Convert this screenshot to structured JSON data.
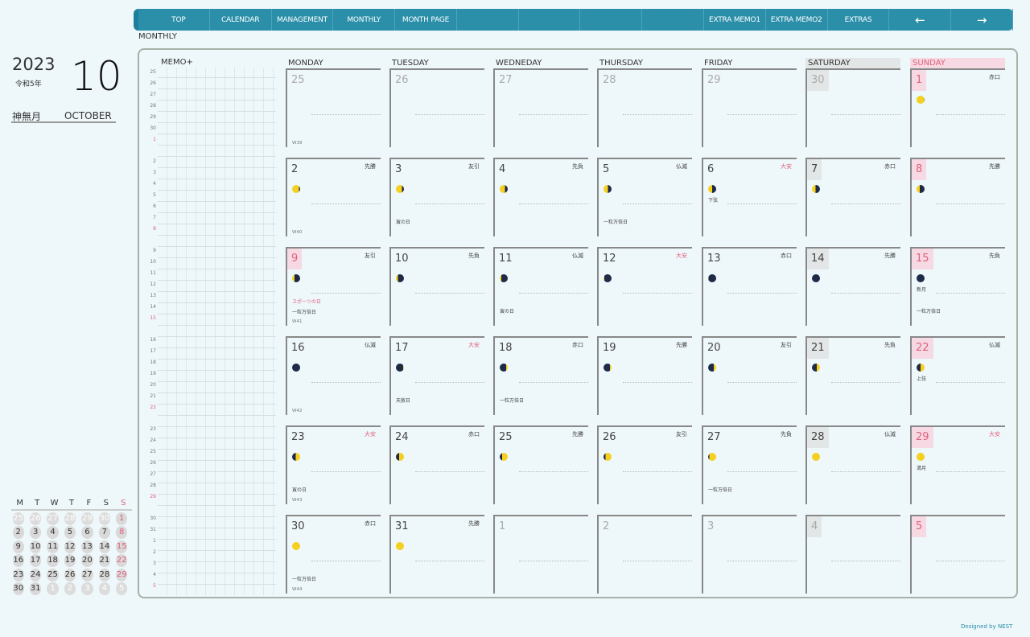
{
  "nav": [
    "TOP",
    "CALENDAR",
    "MANAGEMENT",
    "MONTHLY",
    "MONTH PAGE",
    "",
    "",
    "",
    "",
    "EXTRA MEMO1",
    "EXTRA MEMO2",
    "EXTRAS",
    "←",
    "→"
  ],
  "breadcrumb": "MONTHLY",
  "year": "2023",
  "era": "令和5年",
  "month_number": "10",
  "month_kanji": "神無月",
  "month_english": "OCTOBER",
  "memo_title": "MEMO+",
  "weekdays": [
    "MONDAY",
    "TUESDAY",
    "WEDNEDAY",
    "THURSDAY",
    "FRIDAY",
    "SATURDAY",
    "SUNDAY"
  ],
  "colors": {
    "accent": "#2b8faa",
    "sunday": "#e0607e",
    "saturday_bg": "#e3e6e6",
    "sunday_bg": "#f6d9e2",
    "moon_lit": "#f5d020",
    "moon_dark": "#1f2a48"
  },
  "memo_labels": [
    [
      "25",
      "26",
      "27",
      "28",
      "29",
      "30",
      "1"
    ],
    [
      "2",
      "3",
      "4",
      "5",
      "6",
      "7",
      "8"
    ],
    [
      "9",
      "10",
      "11",
      "12",
      "13",
      "14",
      "15"
    ],
    [
      "16",
      "17",
      "18",
      "19",
      "20",
      "21",
      "22"
    ],
    [
      "23",
      "24",
      "25",
      "26",
      "27",
      "28",
      "29"
    ],
    [
      "30",
      "31",
      "1",
      "2",
      "3",
      "4",
      "5"
    ]
  ],
  "weeks": [
    {
      "label": "W39",
      "days": [
        {
          "date": "25",
          "muted": true
        },
        {
          "date": "26",
          "muted": true
        },
        {
          "date": "27",
          "muted": true
        },
        {
          "date": "28",
          "muted": true
        },
        {
          "date": "29",
          "muted": true
        },
        {
          "date": "30",
          "muted": true
        },
        {
          "date": "1",
          "rokuyo": "赤口",
          "moon": {
            "lit": 0.95,
            "side": "left"
          }
        }
      ]
    },
    {
      "label": "W40",
      "days": [
        {
          "date": "2",
          "rokuyo": "先勝",
          "moon": {
            "lit": 0.85,
            "side": "left"
          }
        },
        {
          "date": "3",
          "rokuyo": "友引",
          "moon": {
            "lit": 0.75,
            "side": "left"
          },
          "note": "寅の日"
        },
        {
          "date": "4",
          "rokuyo": "先負",
          "moon": {
            "lit": 0.65,
            "side": "left"
          }
        },
        {
          "date": "5",
          "rokuyo": "仏滅",
          "moon": {
            "lit": 0.55,
            "side": "left"
          },
          "note": "一粒万倍日"
        },
        {
          "date": "6",
          "rokuyo": "大安",
          "moon": {
            "lit": 0.5,
            "side": "left"
          },
          "moon_label": "下弦"
        },
        {
          "date": "7",
          "rokuyo": "赤口",
          "moon": {
            "lit": 0.45,
            "side": "left"
          }
        },
        {
          "date": "8",
          "rokuyo": "先勝",
          "moon": {
            "lit": 0.4,
            "side": "left"
          }
        }
      ]
    },
    {
      "label": "W41",
      "days": [
        {
          "date": "9",
          "rokuyo": "友引",
          "moon": {
            "lit": 0.3,
            "side": "left"
          },
          "holiday": "スポーツの日",
          "note": "一粒万倍日"
        },
        {
          "date": "10",
          "rokuyo": "先負",
          "moon": {
            "lit": 0.25,
            "side": "left"
          }
        },
        {
          "date": "11",
          "rokuyo": "仏滅",
          "moon": {
            "lit": 0.2,
            "side": "left"
          },
          "note": "寅の日"
        },
        {
          "date": "12",
          "rokuyo": "大安",
          "moon": {
            "lit": 0.12,
            "side": "left"
          }
        },
        {
          "date": "13",
          "rokuyo": "赤口",
          "moon": {
            "lit": 0.03,
            "side": "left"
          }
        },
        {
          "date": "14",
          "rokuyo": "先勝",
          "moon": {
            "lit": 0,
            "side": "left"
          }
        },
        {
          "date": "15",
          "rokuyo": "先負",
          "moon": {
            "lit": 0,
            "side": "left"
          },
          "moon_label": "新月",
          "note": "一粒万倍日"
        }
      ]
    },
    {
      "label": "W42",
      "days": [
        {
          "date": "16",
          "rokuyo": "仏滅",
          "moon": {
            "lit": 0.02,
            "side": "right"
          }
        },
        {
          "date": "17",
          "rokuyo": "大安",
          "moon": {
            "lit": 0.12,
            "side": "right"
          },
          "note": "天赦日"
        },
        {
          "date": "18",
          "rokuyo": "赤口",
          "moon": {
            "lit": 0.18,
            "side": "right"
          },
          "note": "一粒万倍日"
        },
        {
          "date": "19",
          "rokuyo": "先勝",
          "moon": {
            "lit": 0.22,
            "side": "right"
          }
        },
        {
          "date": "20",
          "rokuyo": "友引",
          "moon": {
            "lit": 0.3,
            "side": "right"
          }
        },
        {
          "date": "21",
          "rokuyo": "先負",
          "moon": {
            "lit": 0.42,
            "side": "right"
          }
        },
        {
          "date": "22",
          "rokuyo": "仏滅",
          "moon": {
            "lit": 0.5,
            "side": "right"
          },
          "moon_label": "上弦"
        }
      ]
    },
    {
      "label": "W43",
      "days": [
        {
          "date": "23",
          "rokuyo": "大安",
          "moon": {
            "lit": 0.55,
            "side": "right"
          },
          "note": "寅の日"
        },
        {
          "date": "24",
          "rokuyo": "赤口",
          "moon": {
            "lit": 0.6,
            "side": "right"
          }
        },
        {
          "date": "25",
          "rokuyo": "先勝",
          "moon": {
            "lit": 0.7,
            "side": "right"
          }
        },
        {
          "date": "26",
          "rokuyo": "友引",
          "moon": {
            "lit": 0.75,
            "side": "right"
          }
        },
        {
          "date": "27",
          "rokuyo": "先負",
          "moon": {
            "lit": 0.85,
            "side": "right"
          },
          "note": "一粒万倍日"
        },
        {
          "date": "28",
          "rokuyo": "仏滅",
          "moon": {
            "lit": 1,
            "side": "right"
          }
        },
        {
          "date": "29",
          "rokuyo": "大安",
          "moon": {
            "lit": 1,
            "side": "right"
          },
          "moon_label": "満月"
        }
      ]
    },
    {
      "label": "W44",
      "days": [
        {
          "date": "30",
          "rokuyo": "赤口",
          "moon": {
            "lit": 1,
            "side": "left"
          },
          "note": "一粒万倍日"
        },
        {
          "date": "31",
          "rokuyo": "先勝",
          "moon": {
            "lit": 1,
            "side": "left"
          }
        },
        {
          "date": "1",
          "muted": true
        },
        {
          "date": "2",
          "muted": true
        },
        {
          "date": "3",
          "muted": true
        },
        {
          "date": "4",
          "muted": true
        },
        {
          "date": "5",
          "muted": true
        }
      ]
    }
  ],
  "mini_calendar": {
    "headers": [
      "M",
      "T",
      "W",
      "T",
      "F",
      "S",
      "S"
    ],
    "rows": [
      [
        "25",
        "26",
        "27",
        "28",
        "29",
        "30",
        "1"
      ],
      [
        "2",
        "3",
        "4",
        "5",
        "6",
        "7",
        "8"
      ],
      [
        "9",
        "10",
        "11",
        "12",
        "13",
        "14",
        "15"
      ],
      [
        "16",
        "17",
        "18",
        "19",
        "20",
        "21",
        "22"
      ],
      [
        "23",
        "24",
        "25",
        "26",
        "27",
        "28",
        "29"
      ],
      [
        "30",
        "31",
        "1",
        "2",
        "3",
        "4",
        "5"
      ]
    ]
  },
  "footer": "Designed by NEST"
}
